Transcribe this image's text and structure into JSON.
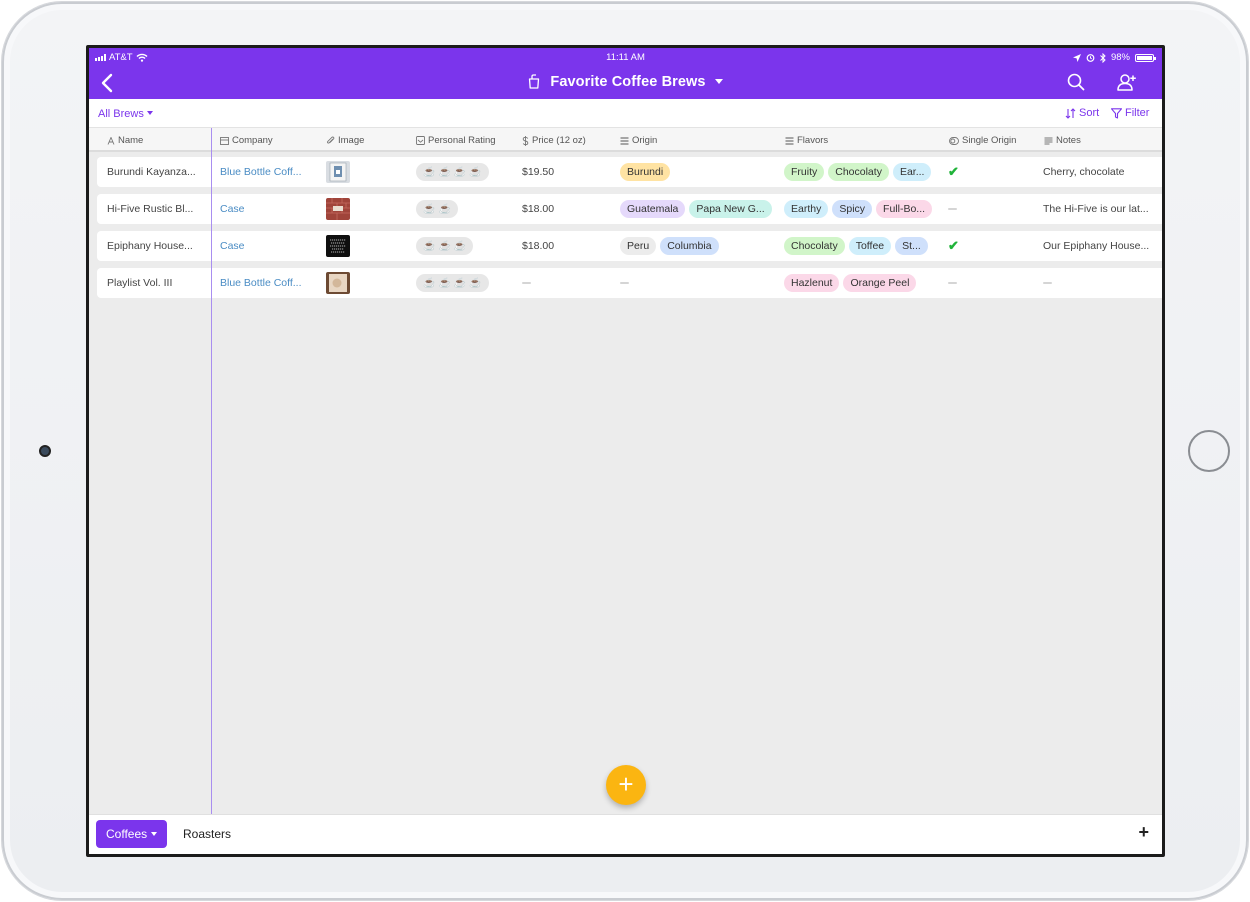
{
  "status_bar": {
    "carrier": "AT&T",
    "time": "11:11 AM",
    "battery": "98%"
  },
  "header": {
    "title": "Favorite Coffee Brews",
    "icons": [
      "back-icon",
      "coffee-cup-icon",
      "search-icon",
      "add-collaborator-icon"
    ]
  },
  "view_bar": {
    "view_name": "All Brews",
    "sort_label": "Sort",
    "filter_label": "Filter"
  },
  "columns": [
    {
      "label": "Name",
      "icon": "name-field-icon"
    },
    {
      "label": "Company",
      "icon": "linked-record-icon"
    },
    {
      "label": "Image",
      "icon": "attachment-icon"
    },
    {
      "label": "Personal Rating",
      "icon": "rating-icon"
    },
    {
      "label": "Price (12 oz)",
      "icon": "currency-icon"
    },
    {
      "label": "Origin",
      "icon": "multi-select-icon"
    },
    {
      "label": "Flavors",
      "icon": "multi-select-icon"
    },
    {
      "label": "Single Origin",
      "icon": "checkbox-field-icon"
    },
    {
      "label": "Notes",
      "icon": "long-text-icon"
    }
  ],
  "rows": [
    {
      "name": "Burundi Kayanza...",
      "company": "Blue Bottle Coff...",
      "rating": 4,
      "price": "$19.50",
      "origin": [
        "Burundi"
      ],
      "flavors": [
        "Fruity",
        "Chocolaty",
        "Ear..."
      ],
      "single_origin": true,
      "notes": "Cherry, chocolate"
    },
    {
      "name": "Hi-Five Rustic Bl...",
      "company": "Case",
      "rating": 2,
      "price": "$18.00",
      "origin": [
        "Guatemala",
        "Papa New G..."
      ],
      "flavors": [
        "Earthy",
        "Spicy",
        "Full-Bo..."
      ],
      "single_origin": false,
      "notes": "The Hi-Five is our lat..."
    },
    {
      "name": "Epiphany House...",
      "company": "Case",
      "rating": 3,
      "price": "$18.00",
      "origin": [
        "Peru",
        "Columbia"
      ],
      "flavors": [
        "Chocolaty",
        "Toffee",
        "St..."
      ],
      "single_origin": true,
      "notes": "Our Epiphany House..."
    },
    {
      "name": "Playlist Vol. III",
      "company": "Blue Bottle Coff...",
      "rating": 4,
      "price": "",
      "origin": [],
      "flavors": [
        "Hazlenut",
        "Orange Peel"
      ],
      "single_origin": false,
      "notes": ""
    }
  ],
  "tag_colors": {
    "Burundi": "#ffe3a3",
    "Guatemala": "#e5d9fb",
    "Papa New G...": "#c9f2ea",
    "Peru": "#ececec",
    "Columbia": "#cfe0fb",
    "Fruity": "#d1f5c9",
    "Chocolaty": "#d1f5c9",
    "Ear...": "#cfeefb",
    "Earthy": "#cfeefb",
    "Spicy": "#cfe0fb",
    "Full-Bo...": "#fbd8e8",
    "Toffee": "#cfeefb",
    "St...": "#cfe0fb",
    "Hazlenut": "#fbd8e8",
    "Orange Peel": "#fbd8e8"
  },
  "bottom_tabs": {
    "active": "Coffees",
    "other": "Roasters"
  },
  "accent_color": "#7b35ec",
  "fab_color": "#fbb511"
}
